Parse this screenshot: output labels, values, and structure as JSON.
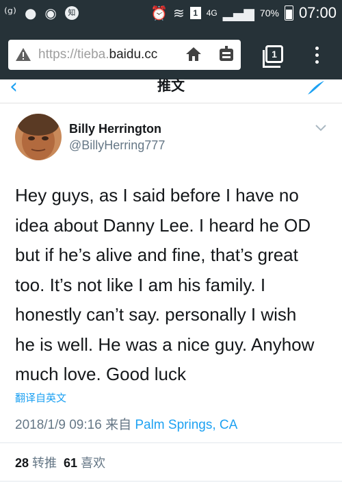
{
  "status_bar": {
    "left_icons": [
      "wifi-signal-icon",
      "wechat-icon",
      "chat-icon",
      "notification-badge-icon"
    ],
    "notification_badge_text": "知",
    "sim_slot": "1",
    "network": "4G",
    "battery": "70%",
    "time": "07:00"
  },
  "browser": {
    "url_scheme": "https://tieba.",
    "url_host": "baidu.cc",
    "tabs_count": "1"
  },
  "header": {
    "title": "推文"
  },
  "tweet": {
    "author_name": "Billy Herrington",
    "author_handle": "@BillyHerring777",
    "text_lines": [
      "Hey guys, as I said  before I have no",
      "idea about Danny Lee. I heard he OD",
      "but if he’s alive and fine, that’s great",
      "too. It’s not like I am his family. I",
      "honestly can’t say.  personally I wish",
      "he is well. He was a nice guy. Anyhow",
      "much love. Good luck"
    ],
    "translate_label": "翻译自英文",
    "timestamp": "2018/1/9 09:16 来自 ",
    "location": "Palm Springs, CA",
    "retweets_count": "28",
    "retweets_label": "转推",
    "likes_count": "61",
    "likes_label": "喜欢"
  },
  "colors": {
    "accent": "#1da1f2",
    "chrome": "#263238",
    "text_primary": "#14171a",
    "text_secondary": "#657786"
  }
}
